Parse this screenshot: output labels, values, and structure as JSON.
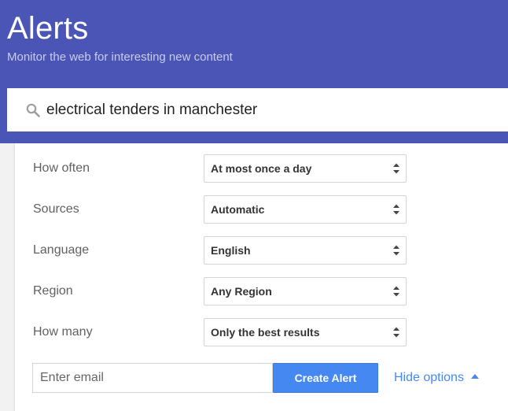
{
  "header": {
    "title": "Alerts",
    "subtitle": "Monitor the web for interesting new content"
  },
  "search": {
    "icon": "search-icon",
    "value": "electrical tenders in manchester"
  },
  "options": [
    {
      "label": "How often",
      "value": "At most once a day"
    },
    {
      "label": "Sources",
      "value": "Automatic"
    },
    {
      "label": "Language",
      "value": "English"
    },
    {
      "label": "Region",
      "value": "Any Region"
    },
    {
      "label": "How many",
      "value": "Only the best results"
    }
  ],
  "email": {
    "placeholder": "Enter email",
    "value": ""
  },
  "create_button": {
    "label": "Create Alert"
  },
  "hide_options": {
    "label": "Hide options",
    "icon": "caret-up-icon"
  },
  "colors": {
    "header_bg": "#4a55b6",
    "accent": "#4688f1"
  }
}
